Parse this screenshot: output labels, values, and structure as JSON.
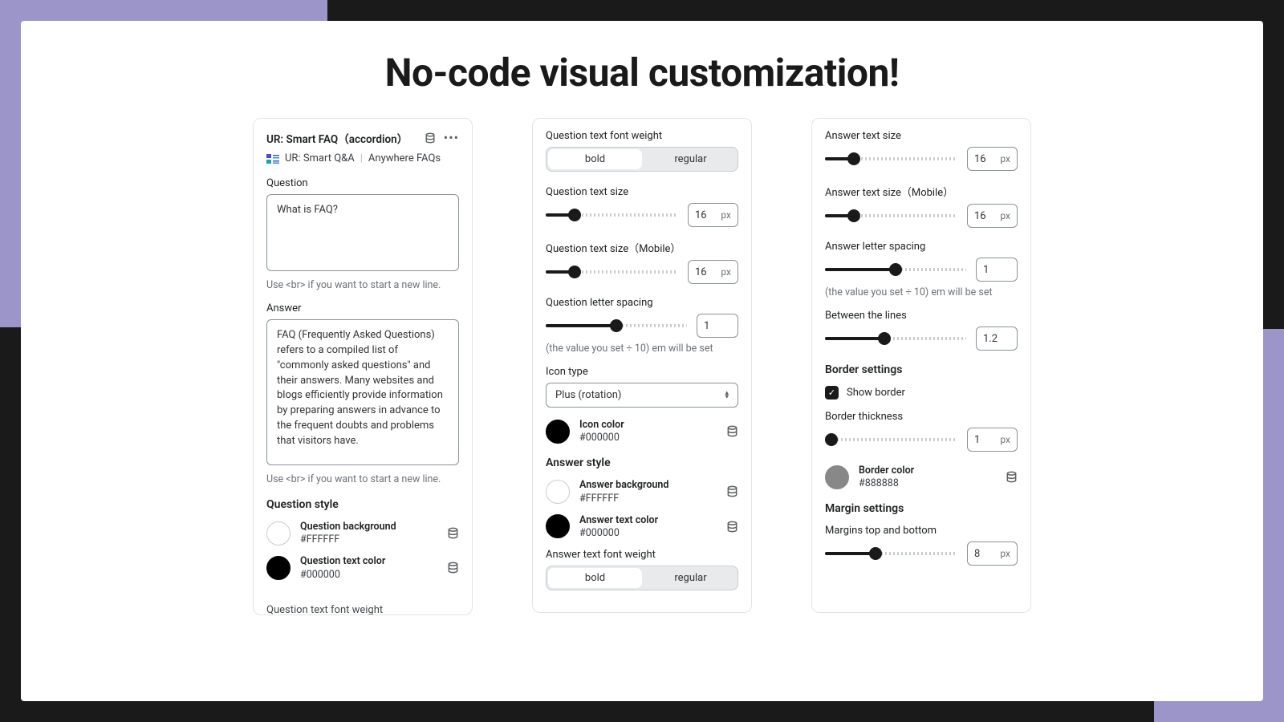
{
  "headline": "No-code visual customization!",
  "panel1": {
    "title": "UR: Smart FAQ（accordion）",
    "bc1": "UR: Smart Q&A",
    "bc2": "Anywhere FAQs",
    "question_label": "Question",
    "question_value": "What is FAQ?",
    "question_help": "Use <br> if you want to start a new line.",
    "answer_label": "Answer",
    "answer_value": "FAQ (Frequently Asked Questions) refers to a compiled list of \"commonly asked questions\" and their answers. Many websites and blogs efficiently provide information by preparing answers in advance to the frequent doubts and problems that visitors have.",
    "answer_help": "Use <br> if you want to start a new line.",
    "q_style_title": "Question style",
    "q_bg_name": "Question background",
    "q_bg_hex": "#FFFFFF",
    "q_color_name": "Question text color",
    "q_color_hex": "#000000",
    "cut": "Question text font weight"
  },
  "panel2": {
    "fw_label": "Question text font weight",
    "bold": "bold",
    "regular": "regular",
    "size_label": "Question text size",
    "size_val": "16",
    "size_unit": "px",
    "size_m_label": "Question text size（Mobile）",
    "size_m_val": "16",
    "ls_label": "Question letter spacing",
    "ls_val": "1",
    "ls_help": "(the value you set ÷ 10) em will be set",
    "icon_type_label": "Icon type",
    "icon_type_val": "Plus (rotation)",
    "icon_color_name": "Icon color",
    "icon_color_hex": "#000000",
    "ans_style_title": "Answer style",
    "ans_bg_name": "Answer background",
    "ans_bg_hex": "#FFFFFF",
    "ans_color_name": "Answer text color",
    "ans_color_hex": "#000000",
    "ans_fw_label": "Answer text font weight"
  },
  "panel3": {
    "ans_size_label": "Answer text size",
    "ans_size_val": "16",
    "unit_px": "px",
    "ans_size_m_label": "Answer text size（Mobile）",
    "ans_size_m_val": "16",
    "ans_ls_label": "Answer letter spacing",
    "ans_ls_val": "1",
    "ans_ls_help": "(the value you set ÷ 10) em will be set",
    "lines_label": "Between the lines",
    "lines_val": "1.2",
    "border_title": "Border settings",
    "show_border": "Show border",
    "border_thick_label": "Border thickness",
    "border_thick_val": "1",
    "border_color_name": "Border color",
    "border_color_hex": "#888888",
    "margin_title": "Margin settings",
    "margin_tb_label": "Margins top and bottom",
    "margin_tb_val": "8"
  }
}
